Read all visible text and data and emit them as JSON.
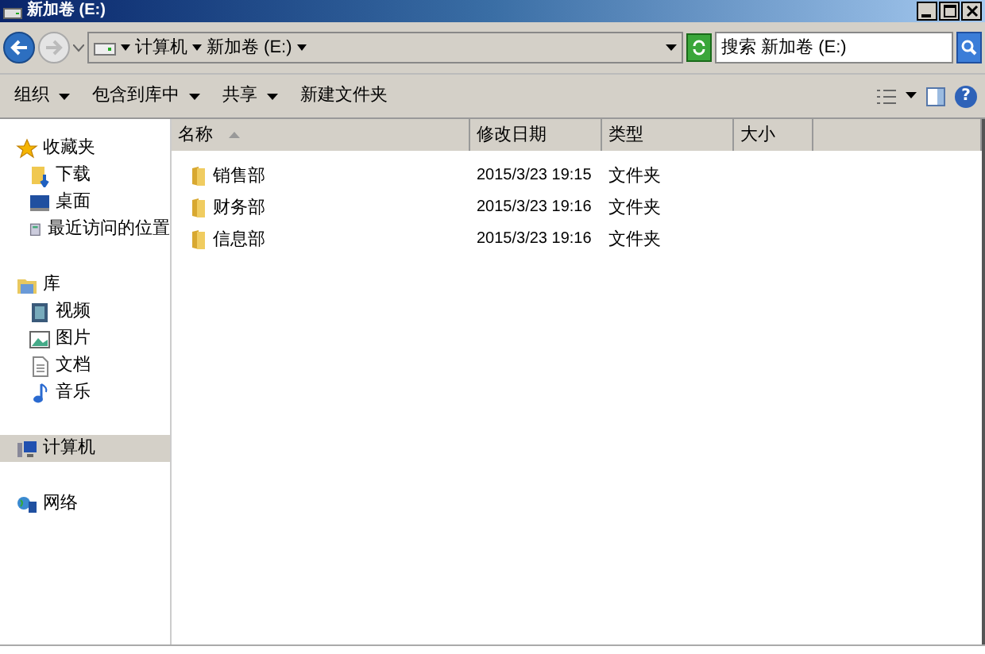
{
  "window": {
    "title": "新加卷 (E:)"
  },
  "address_bar": {
    "path": [
      {
        "label": "计算机"
      },
      {
        "label": "新加卷 (E:)"
      }
    ]
  },
  "search": {
    "placeholder": "搜索 新加卷 (E:)"
  },
  "toolbar": [
    {
      "label": "组织",
      "dropdown": true
    },
    {
      "label": "包含到库中",
      "dropdown": true
    },
    {
      "label": "共享",
      "dropdown": true
    },
    {
      "label": "新建文件夹",
      "dropdown": false
    }
  ],
  "help_button": {
    "label": "?"
  },
  "sidebar": {
    "items": [
      {
        "label": "收藏夹",
        "selected": false,
        "children": [
          {
            "label": "下载",
            "selected": false
          },
          {
            "label": "桌面",
            "selected": false
          },
          {
            "label": "最近访问的位置",
            "selected": false
          }
        ]
      },
      {
        "label": "库",
        "selected": false,
        "children": [
          {
            "label": "视频",
            "selected": false
          },
          {
            "label": "图片",
            "selected": false
          },
          {
            "label": "文档",
            "selected": false
          },
          {
            "label": "音乐",
            "selected": false
          }
        ]
      },
      {
        "label": "计算机",
        "selected": true
      },
      {
        "label": "网络",
        "selected": false
      }
    ]
  },
  "table": {
    "columns": [
      {
        "label": "名称",
        "sorted": true
      },
      {
        "label": "修改日期",
        "sorted": false
      },
      {
        "label": "类型",
        "sorted": false
      },
      {
        "label": "大小",
        "sorted": false
      }
    ],
    "rows": [
      {
        "name": "销售部",
        "modified": "2015/3/23 19:15",
        "type": "文件夹"
      },
      {
        "name": "财务部",
        "modified": "2015/3/23 19:16",
        "type": "文件夹"
      },
      {
        "name": "信息部",
        "modified": "2015/3/23 19:16",
        "type": "文件夹"
      }
    ]
  }
}
